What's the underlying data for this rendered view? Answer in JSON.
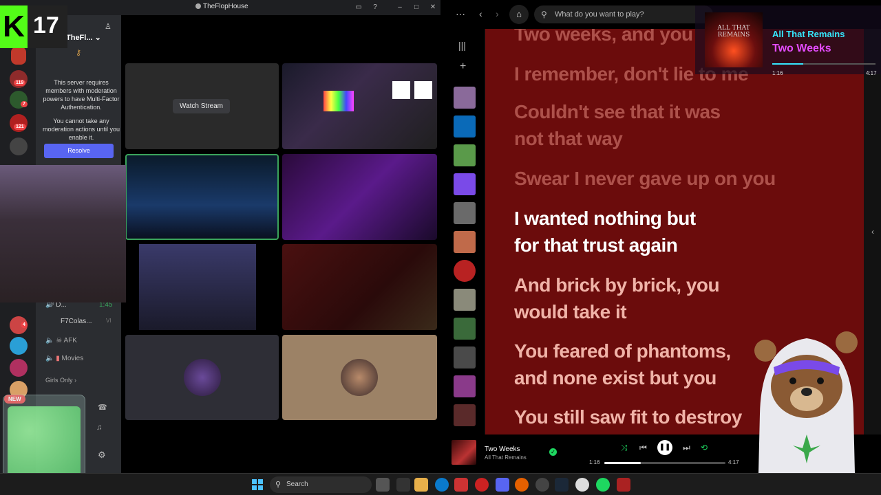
{
  "discord": {
    "window_title": "TheFlopHouse",
    "server_name": "TheFl...",
    "mfa_message": "This server requires members with moderation powers to have Multi-Factor Authentication.",
    "mfa_sub": "You cannot take any moderation actions until you enable it.",
    "resolve_label": "Resolve",
    "guild_badges": [
      "119",
      "7",
      "121",
      "4"
    ],
    "new_badge": "NEW",
    "voice": [
      {
        "label": "D...",
        "time": "1:45"
      },
      {
        "label": "F7Colas...",
        "tag": "VI"
      },
      {
        "label": "AFK"
      },
      {
        "label": "Movies"
      }
    ],
    "category": "Girls Only",
    "watch_stream_label": "Watch Stream"
  },
  "overlay": {
    "kick_count": "17"
  },
  "spotify": {
    "search_placeholder": "What do you want to play?",
    "lyrics": [
      {
        "text": "Two weeks, and you",
        "state": "past"
      },
      {
        "text": "I remember, don't lie to me",
        "state": "past"
      },
      {
        "text": "Couldn't see that it was not that way",
        "state": "past"
      },
      {
        "text": "Swear I never gave up on you",
        "state": "past"
      },
      {
        "text": "I wanted nothing but for that trust again",
        "state": "now"
      },
      {
        "text": "And brick by brick, you would take it",
        "state": "next"
      },
      {
        "text": "You feared of phantoms, and none exist but you",
        "state": "next"
      },
      {
        "text": "You still saw fit to destroy",
        "state": "next"
      }
    ],
    "now_playing": {
      "title": "Two Weeks",
      "artist": "All That Remains",
      "elapsed": "1:16",
      "duration": "4:17",
      "progress": 0.3
    }
  },
  "np_overlay": {
    "artist": "All That Remains",
    "track": "Two Weeks",
    "album_text": "ALL THAT REMAINS",
    "elapsed": "1:16",
    "duration": "4:17",
    "progress": 0.3
  },
  "taskbar": {
    "search_label": "Search"
  },
  "colors": {
    "kick_green": "#53fc18",
    "discord_blurple": "#5865f2",
    "lyrics_bg": "#6b0c0c",
    "overlay_cyan": "#35e8ff",
    "overlay_magenta": "#e44cff"
  }
}
